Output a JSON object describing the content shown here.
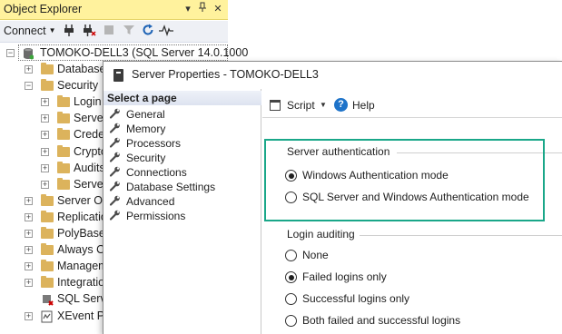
{
  "object_explorer": {
    "title": "Object Explorer",
    "title_buttons": [
      "▾",
      "ᵖ",
      "✕"
    ],
    "toolbar": {
      "connect_label": "Connect",
      "icons": [
        "connect-icon",
        "disconnect-icon",
        "stop-icon",
        "filter-icon",
        "refresh-icon",
        "activity-monitor-icon"
      ]
    },
    "server_label": "TOMOKO-DELL3 (SQL Server 14.0.1000",
    "nodes": [
      {
        "label": "Databases",
        "expander": "+",
        "depth": 1
      },
      {
        "label": "Security",
        "expander": "−",
        "depth": 1
      },
      {
        "label": "Login",
        "expander": "+",
        "depth": 2
      },
      {
        "label": "Server",
        "expander": "+",
        "depth": 2
      },
      {
        "label": "Crede",
        "expander": "+",
        "depth": 2
      },
      {
        "label": "Crypto",
        "expander": "+",
        "depth": 2
      },
      {
        "label": "Audits",
        "expander": "+",
        "depth": 2
      },
      {
        "label": "Server",
        "expander": "+",
        "depth": 2
      },
      {
        "label": "Server Ob",
        "expander": "+",
        "depth": 1
      },
      {
        "label": "Replicatio",
        "expander": "+",
        "depth": 1
      },
      {
        "label": "PolyBase",
        "expander": "+",
        "depth": 1
      },
      {
        "label": "Always O",
        "expander": "+",
        "depth": 1
      },
      {
        "label": "Managem",
        "expander": "+",
        "depth": 1
      },
      {
        "label": "Integratio",
        "expander": "+",
        "depth": 1
      },
      {
        "label": "SQL Serve",
        "expander": "",
        "depth": 1
      },
      {
        "label": "XEvent Pr",
        "expander": "+",
        "depth": 1
      }
    ]
  },
  "dialog": {
    "title": "Server Properties - TOMOKO-DELL3",
    "select_page_label": "Select a page",
    "pages": [
      "General",
      "Memory",
      "Processors",
      "Security",
      "Connections",
      "Database Settings",
      "Advanced",
      "Permissions"
    ],
    "toolbar": {
      "script_label": "Script",
      "help_label": "Help"
    },
    "server_authentication": {
      "heading": "Server authentication",
      "options": [
        {
          "label": "Windows Authentication mode",
          "selected": true
        },
        {
          "label": "SQL Server and Windows Authentication mode",
          "selected": false
        }
      ]
    },
    "login_auditing": {
      "heading": "Login auditing",
      "options": [
        {
          "label": "None",
          "selected": false
        },
        {
          "label": "Failed logins only",
          "selected": true
        },
        {
          "label": "Successful logins only",
          "selected": false
        },
        {
          "label": "Both failed and successful logins",
          "selected": false
        }
      ]
    }
  },
  "colors": {
    "oe_title_bar": "#fff29d",
    "highlight_box": "#1aa789",
    "folder": "#dcb35c"
  }
}
